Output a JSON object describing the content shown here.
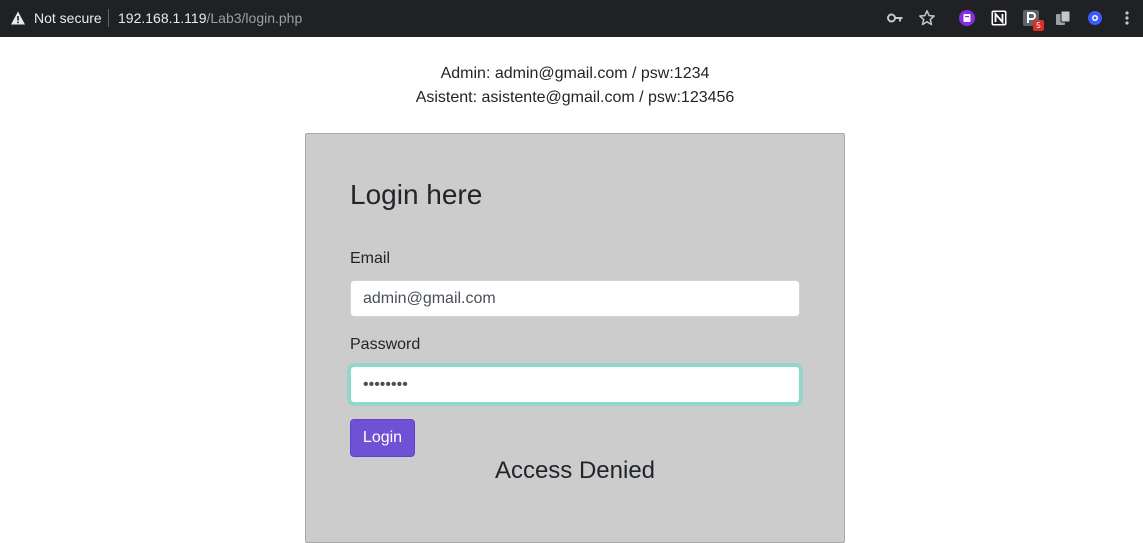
{
  "browser": {
    "security_label": "Not secure",
    "url_host": "192.168.1.119",
    "url_path": "/Lab3/login.php",
    "extension_badge": "5",
    "icons": [
      "warning-icon",
      "key-icon",
      "star-icon",
      "extension-purple-icon",
      "notion-icon",
      "extension-p-icon",
      "extension-copy-icon",
      "extension-blue-icon"
    ]
  },
  "credentials": {
    "admin_line": "Admin: admin@gmail.com / psw:1234",
    "assistant_line": "Asistent: asistente@gmail.com / psw:123456"
  },
  "login": {
    "title": "Login here",
    "email_label": "Email",
    "email_value": "admin@gmail.com",
    "password_label": "Password",
    "password_value": "••••••••",
    "button_label": "Login",
    "status_message": "Access Denied"
  },
  "colors": {
    "card_background": "#cccccc",
    "button_background": "#6f51d6",
    "focus_ring": "#80e0d0",
    "browser_bar": "#202124"
  }
}
